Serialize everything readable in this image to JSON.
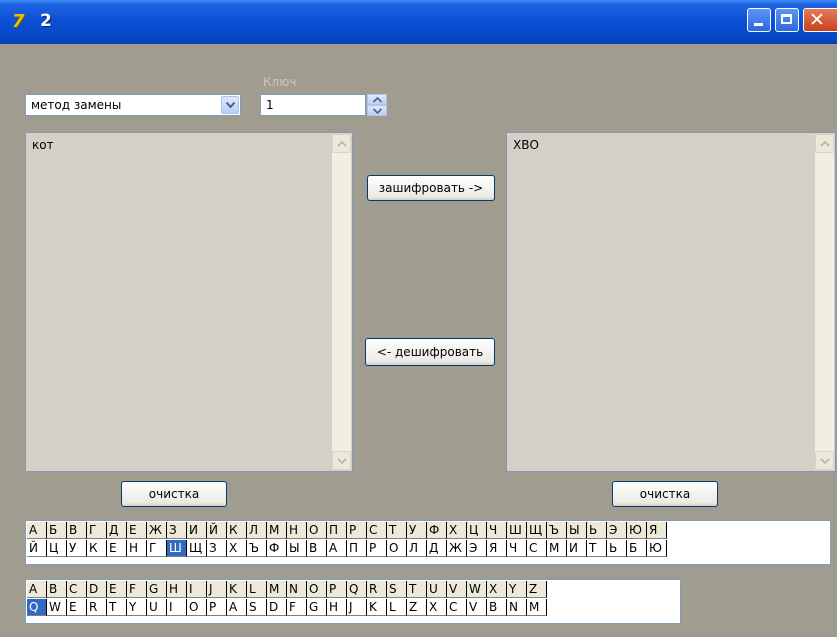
{
  "window": {
    "title": "2"
  },
  "controls": {
    "key_label": "Ключ",
    "method_value": "метод замены",
    "key_value": "1"
  },
  "memo_left": {
    "text": "кот"
  },
  "memo_right": {
    "text": "ХВО"
  },
  "buttons": {
    "encrypt": "зашифровать ->",
    "decrypt": "<- дешифровать",
    "clear_left": "очистка",
    "clear_right": "очистка"
  },
  "ru_alphabet": {
    "top": [
      "А",
      "Б",
      "В",
      "Г",
      "Д",
      "Е",
      "Ж",
      "З",
      "И",
      "Й",
      "К",
      "Л",
      "М",
      "Н",
      "О",
      "П",
      "Р",
      "С",
      "Т",
      "У",
      "Ф",
      "Х",
      "Ц",
      "Ч",
      "Ш",
      "Щ",
      "Ъ",
      "Ы",
      "Ь",
      "Э",
      "Ю",
      "Я"
    ],
    "bottom": [
      "Й",
      "Ц",
      "У",
      "К",
      "Е",
      "Н",
      "Г",
      "Ш",
      "Щ",
      "З",
      "Х",
      "Ъ",
      "Ф",
      "Ы",
      "В",
      "А",
      "П",
      "Р",
      "О",
      "Л",
      "Д",
      "Ж",
      "Э",
      "Я",
      "Ч",
      "С",
      "М",
      "И",
      "Т",
      "Ь",
      "Б",
      "Ю"
    ],
    "selected_bottom_index": 7
  },
  "en_alphabet": {
    "top": [
      "A",
      "B",
      "C",
      "D",
      "E",
      "F",
      "G",
      "H",
      "I",
      "J",
      "K",
      "L",
      "M",
      "N",
      "O",
      "P",
      "Q",
      "R",
      "S",
      "T",
      "U",
      "V",
      "W",
      "X",
      "Y",
      "Z"
    ],
    "bottom": [
      "Q",
      "W",
      "E",
      "R",
      "T",
      "Y",
      "U",
      "I",
      "O",
      "P",
      "A",
      "S",
      "D",
      "F",
      "G",
      "H",
      "J",
      "K",
      "L",
      "Z",
      "X",
      "C",
      "V",
      "B",
      "N",
      "M"
    ],
    "selected_bottom_index": 0
  }
}
